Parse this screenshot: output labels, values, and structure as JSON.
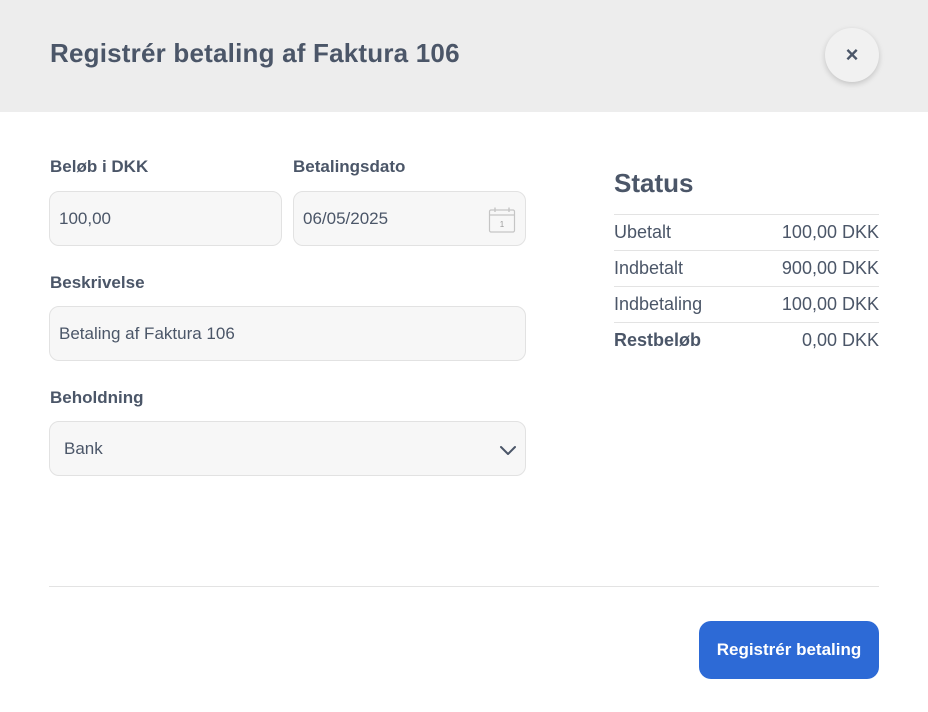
{
  "dialog": {
    "title": "Registrér betaling af Faktura 106",
    "close_label": "×"
  },
  "form": {
    "amount": {
      "label": "Beløb i DKK",
      "value": "100,00"
    },
    "date": {
      "label": "Betalingsdato",
      "value": "06/05/2025",
      "calendar_day": "1"
    },
    "description": {
      "label": "Beskrivelse",
      "value": "Betaling af Faktura 106"
    },
    "holding": {
      "label": "Beholdning",
      "value": "Bank"
    }
  },
  "status": {
    "title": "Status",
    "rows": [
      {
        "label": "Ubetalt",
        "value": "100,00 DKK"
      },
      {
        "label": "Indbetalt",
        "value": "900,00 DKK"
      },
      {
        "label": "Indbetaling",
        "value": "100,00 DKK"
      },
      {
        "label": "Restbeløb",
        "value": "0,00 DKK"
      }
    ]
  },
  "footer": {
    "submit_label": "Registrér betaling"
  },
  "colors": {
    "primary": "#2d6ad6",
    "text": "#4b5668",
    "header_bg": "#ededed",
    "field_bg": "#f7f7f7"
  },
  "icons": {
    "close": "close-icon",
    "date": "calendar-icon",
    "select": "chevron-down-icon"
  }
}
